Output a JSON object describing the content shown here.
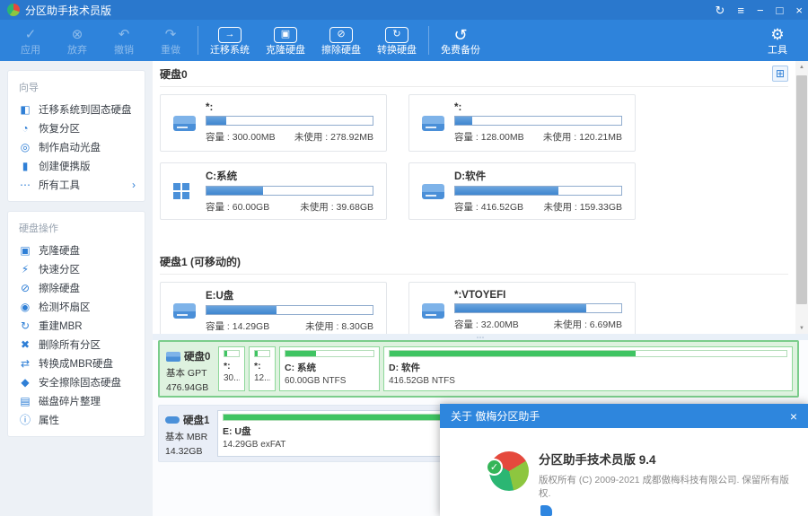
{
  "app": {
    "title": "分区助手技术员版"
  },
  "icons": {
    "refresh": "↻",
    "menu": "≡",
    "minimize": "−",
    "maximize": "□",
    "close": "×",
    "view_toggle": "⊞",
    "scroll_up": "▲",
    "scroll_down": "▼",
    "splitter": "⋯",
    "check_badge": "✓",
    "chevron_right": "›"
  },
  "toolbar": {
    "disabled_buttons": [
      {
        "label": "应用",
        "icon": "✓"
      },
      {
        "label": "放弃",
        "icon": "⊗"
      },
      {
        "label": "撤销",
        "icon": "↶"
      },
      {
        "label": "重做",
        "icon": "↷"
      }
    ],
    "disk_buttons": [
      {
        "label": "迁移系统",
        "icon": "→"
      },
      {
        "label": "克隆硬盘",
        "icon": "▣"
      },
      {
        "label": "擦除硬盘",
        "icon": "⊘"
      },
      {
        "label": "转换硬盘",
        "icon": "↻"
      }
    ],
    "backup_button": {
      "label": "免费备份",
      "icon": "↺"
    },
    "tools_button": {
      "label": "工具",
      "icon": "⚙"
    }
  },
  "sidebar": {
    "sections": [
      {
        "title": "向导",
        "items": [
          {
            "label": "迁移系统到固态硬盘",
            "icon": "◧"
          },
          {
            "label": "恢复分区",
            "icon": "◔"
          },
          {
            "label": "制作启动光盘",
            "icon": "◎"
          },
          {
            "label": "创建便携版",
            "icon": "▮"
          },
          {
            "label": "所有工具",
            "icon": "⋯"
          }
        ]
      },
      {
        "title": "硬盘操作",
        "items": [
          {
            "label": "克隆硬盘",
            "icon": "▣"
          },
          {
            "label": "快速分区",
            "icon": "⚡"
          },
          {
            "label": "擦除硬盘",
            "icon": "⊘"
          },
          {
            "label": "检测坏扇区",
            "icon": "◉"
          },
          {
            "label": "重建MBR",
            "icon": "↻"
          },
          {
            "label": "删除所有分区",
            "icon": "✖"
          },
          {
            "label": "转换成MBR硬盘",
            "icon": "⇄"
          },
          {
            "label": "安全擦除固态硬盘",
            "icon": "◆"
          },
          {
            "label": "磁盘碎片整理",
            "icon": "▤"
          },
          {
            "label": "属性",
            "icon": "ⓘ"
          }
        ]
      }
    ]
  },
  "disks": [
    {
      "header": "硬盘0",
      "volumes": [
        {
          "name": "*:",
          "capacity": "容量 : 300.00MB",
          "free": "未使用 : 278.92MB",
          "used_pct": "12%"
        },
        {
          "name": "*:",
          "capacity": "容量 : 128.00MB",
          "free": "未使用 : 120.21MB",
          "used_pct": "10%"
        },
        {
          "name": "C:系统",
          "capacity": "容量 : 60.00GB",
          "free": "未使用 : 39.68GB",
          "used_pct": "34%"
        },
        {
          "name": "D:软件",
          "capacity": "容量 : 416.52GB",
          "free": "未使用 : 159.33GB",
          "used_pct": "62%"
        }
      ]
    },
    {
      "header": "硬盘1 (可移动的)",
      "volumes": [
        {
          "name": "E:U盘",
          "capacity": "容量 : 14.29GB",
          "free": "未使用 : 8.30GB",
          "used_pct": "42%"
        },
        {
          "name": "*:VTOYEFI",
          "capacity": "容量 : 32.00MB",
          "free": "未使用 : 6.69MB",
          "used_pct": "79%"
        }
      ]
    }
  ],
  "bottom_panel": {
    "disk0": {
      "name": "硬盘0",
      "type": "基本 GPT",
      "size": "476.94GB",
      "blocks": [
        {
          "name": "*:",
          "info": "30...",
          "used_pct": "18%"
        },
        {
          "name": "*:",
          "info": "12...",
          "used_pct": "18%"
        },
        {
          "name": "C: 系统",
          "info": "60.00GB NTFS",
          "used_pct": "35%"
        },
        {
          "name": "D: 软件",
          "info": "416.52GB NTFS",
          "used_pct": "62%"
        }
      ]
    },
    "disk1": {
      "name": "硬盘1",
      "type": "基本 MBR",
      "size": "14.32GB",
      "blocks": [
        {
          "name": "E: U盘",
          "info": "14.29GB exFAT",
          "used_pct": "97%"
        }
      ]
    }
  },
  "dialog": {
    "title": "关于 傲梅分区助手",
    "product_name": "分区助手技术员版 9.4",
    "copyright": "版权所有 (C) 2009-2021 成都傲梅科技有限公司. 保留所有版权."
  },
  "colors": {
    "titlebar_blue": "#2A78CD",
    "toolbar_blue": "#2E83DB",
    "accent_blue": "#2F7FD6",
    "bar_fill_blue": "#4E94DB",
    "green_fill": "#3FC462",
    "disk0_row_bg": "#DEF2DF",
    "disk0_row_border": "#7BCD8B",
    "disk1_row_bg": "#E9EEF7"
  }
}
